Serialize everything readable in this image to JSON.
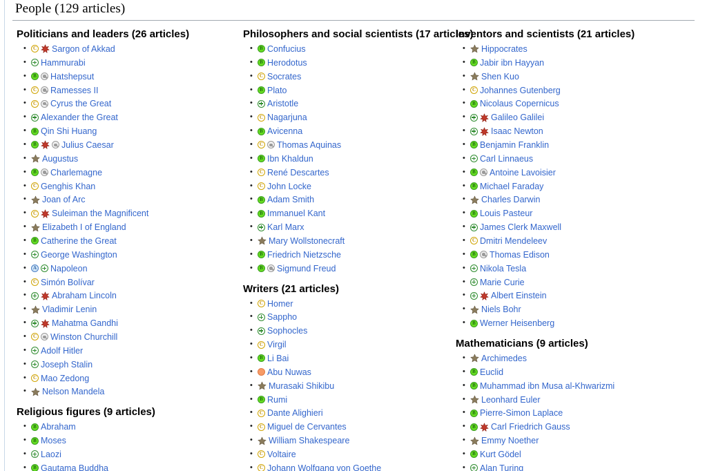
{
  "page": {
    "title": "People (129 articles)"
  },
  "icon_colors": {
    "featured_star": "#c0392b",
    "plain_star": "#8a7b5c",
    "b_class_green": "#66dd22",
    "c_class_yellow": "#d0a400",
    "a_class_blue": "#cfe4f7",
    "good_article_green": "#2e8b2e",
    "start_class_orange": "#f79b67",
    "grey_review": "#9a9a9a",
    "link_blue": "#3366cc"
  },
  "icon_names": {
    "B": "b-class-icon",
    "C": "c-class-icon",
    "A": "a-class-icon",
    "GA": "good-article-plus-icon",
    "FA": "featured-article-red-star-icon",
    "STAR": "bronze-star-icon",
    "START": "start-class-orange-circle-icon",
    "GREY": "grey-review-circle-icon"
  },
  "columns": [
    {
      "name": "column-one",
      "sections": [
        {
          "heading": "Politicians and leaders (26 articles)",
          "items": [
            {
              "icons": [
                "C",
                "FA"
              ],
              "label": "Sargon of Akkad"
            },
            {
              "icons": [
                "GA"
              ],
              "label": "Hammurabi"
            },
            {
              "icons": [
                "B",
                "GREY"
              ],
              "label": "Hatshepsut"
            },
            {
              "icons": [
                "C",
                "GREY"
              ],
              "label": "Ramesses II"
            },
            {
              "icons": [
                "C",
                "GREY"
              ],
              "label": "Cyrus the Great"
            },
            {
              "icons": [
                "GA"
              ],
              "label": "Alexander the Great"
            },
            {
              "icons": [
                "B"
              ],
              "label": "Qin Shi Huang"
            },
            {
              "icons": [
                "B",
                "FA",
                "GREY"
              ],
              "label": "Julius Caesar"
            },
            {
              "icons": [
                "STAR"
              ],
              "label": "Augustus"
            },
            {
              "icons": [
                "B",
                "GREY"
              ],
              "label": "Charlemagne"
            },
            {
              "icons": [
                "C"
              ],
              "label": "Genghis Khan"
            },
            {
              "icons": [
                "STAR"
              ],
              "label": "Joan of Arc"
            },
            {
              "icons": [
                "C",
                "FA"
              ],
              "label": "Suleiman the Magnificent"
            },
            {
              "icons": [
                "STAR"
              ],
              "label": "Elizabeth I of England"
            },
            {
              "icons": [
                "B"
              ],
              "label": "Catherine the Great"
            },
            {
              "icons": [
                "GA"
              ],
              "label": "George Washington"
            },
            {
              "icons": [
                "A",
                "GA"
              ],
              "label": "Napoleon"
            },
            {
              "icons": [
                "C"
              ],
              "label": "Simón Bolívar"
            },
            {
              "icons": [
                "GA",
                "FA"
              ],
              "label": "Abraham Lincoln"
            },
            {
              "icons": [
                "STAR"
              ],
              "label": "Vladimir Lenin"
            },
            {
              "icons": [
                "GA",
                "FA"
              ],
              "label": "Mahatma Gandhi"
            },
            {
              "icons": [
                "C",
                "GREY"
              ],
              "label": "Winston Churchill"
            },
            {
              "icons": [
                "GA"
              ],
              "label": "Adolf Hitler"
            },
            {
              "icons": [
                "GA"
              ],
              "label": "Joseph Stalin"
            },
            {
              "icons": [
                "C"
              ],
              "label": "Mao Zedong"
            },
            {
              "icons": [
                "STAR"
              ],
              "label": "Nelson Mandela"
            }
          ]
        },
        {
          "heading": "Religious figures (9 articles)",
          "items": [
            {
              "icons": [
                "B"
              ],
              "label": "Abraham"
            },
            {
              "icons": [
                "B"
              ],
              "label": "Moses"
            },
            {
              "icons": [
                "GA"
              ],
              "label": "Laozi"
            },
            {
              "icons": [
                "B"
              ],
              "label": "Gautama Buddha"
            }
          ]
        }
      ]
    },
    {
      "name": "column-two",
      "sections": [
        {
          "heading": "Philosophers and social scientists (17 articles)",
          "items": [
            {
              "icons": [
                "B"
              ],
              "label": "Confucius"
            },
            {
              "icons": [
                "B"
              ],
              "label": "Herodotus"
            },
            {
              "icons": [
                "C"
              ],
              "label": "Socrates"
            },
            {
              "icons": [
                "B"
              ],
              "label": "Plato"
            },
            {
              "icons": [
                "GA"
              ],
              "label": "Aristotle"
            },
            {
              "icons": [
                "C"
              ],
              "label": "Nagarjuna"
            },
            {
              "icons": [
                "B"
              ],
              "label": "Avicenna"
            },
            {
              "icons": [
                "C",
                "GREY"
              ],
              "label": "Thomas Aquinas"
            },
            {
              "icons": [
                "B"
              ],
              "label": "Ibn Khaldun"
            },
            {
              "icons": [
                "C"
              ],
              "label": "René Descartes"
            },
            {
              "icons": [
                "C"
              ],
              "label": "John Locke"
            },
            {
              "icons": [
                "B"
              ],
              "label": "Adam Smith"
            },
            {
              "icons": [
                "B"
              ],
              "label": "Immanuel Kant"
            },
            {
              "icons": [
                "GA"
              ],
              "label": "Karl Marx"
            },
            {
              "icons": [
                "STAR"
              ],
              "label": "Mary Wollstonecraft"
            },
            {
              "icons": [
                "B"
              ],
              "label": "Friedrich Nietzsche"
            },
            {
              "icons": [
                "B",
                "GREY"
              ],
              "label": "Sigmund Freud"
            }
          ]
        },
        {
          "heading": "Writers (21 articles)",
          "items": [
            {
              "icons": [
                "C"
              ],
              "label": "Homer"
            },
            {
              "icons": [
                "GA"
              ],
              "label": "Sappho"
            },
            {
              "icons": [
                "GA"
              ],
              "label": "Sophocles"
            },
            {
              "icons": [
                "C"
              ],
              "label": "Virgil"
            },
            {
              "icons": [
                "B"
              ],
              "label": "Li Bai"
            },
            {
              "icons": [
                "START"
              ],
              "label": "Abu Nuwas"
            },
            {
              "icons": [
                "STAR"
              ],
              "label": "Murasaki Shikibu"
            },
            {
              "icons": [
                "B"
              ],
              "label": "Rumi"
            },
            {
              "icons": [
                "C"
              ],
              "label": "Dante Alighieri"
            },
            {
              "icons": [
                "C"
              ],
              "label": "Miguel de Cervantes"
            },
            {
              "icons": [
                "STAR"
              ],
              "label": "William Shakespeare"
            },
            {
              "icons": [
                "C"
              ],
              "label": "Voltaire"
            },
            {
              "icons": [
                "C"
              ],
              "label": "Johann Wolfgang von Goethe"
            }
          ]
        }
      ]
    },
    {
      "name": "column-three",
      "sections": [
        {
          "heading": "Inventors and scientists (21 articles)",
          "items": [
            {
              "icons": [
                "STAR"
              ],
              "label": "Hippocrates"
            },
            {
              "icons": [
                "B"
              ],
              "label": "Jabir ibn Hayyan"
            },
            {
              "icons": [
                "STAR"
              ],
              "label": "Shen Kuo"
            },
            {
              "icons": [
                "C"
              ],
              "label": "Johannes Gutenberg"
            },
            {
              "icons": [
                "B"
              ],
              "label": "Nicolaus Copernicus"
            },
            {
              "icons": [
                "GA",
                "FA"
              ],
              "label": "Galileo Galilei"
            },
            {
              "icons": [
                "GA",
                "FA"
              ],
              "label": "Isaac Newton"
            },
            {
              "icons": [
                "B"
              ],
              "label": "Benjamin Franklin"
            },
            {
              "icons": [
                "GA"
              ],
              "label": "Carl Linnaeus"
            },
            {
              "icons": [
                "B",
                "GREY"
              ],
              "label": "Antoine Lavoisier"
            },
            {
              "icons": [
                "B"
              ],
              "label": "Michael Faraday"
            },
            {
              "icons": [
                "STAR"
              ],
              "label": "Charles Darwin"
            },
            {
              "icons": [
                "B"
              ],
              "label": "Louis Pasteur"
            },
            {
              "icons": [
                "GA"
              ],
              "label": "James Clerk Maxwell"
            },
            {
              "icons": [
                "C"
              ],
              "label": "Dmitri Mendeleev"
            },
            {
              "icons": [
                "B",
                "GREY"
              ],
              "label": "Thomas Edison"
            },
            {
              "icons": [
                "GA"
              ],
              "label": "Nikola Tesla"
            },
            {
              "icons": [
                "GA"
              ],
              "label": "Marie Curie"
            },
            {
              "icons": [
                "GA",
                "FA"
              ],
              "label": "Albert Einstein"
            },
            {
              "icons": [
                "STAR"
              ],
              "label": "Niels Bohr"
            },
            {
              "icons": [
                "B"
              ],
              "label": "Werner Heisenberg"
            }
          ]
        },
        {
          "heading": "Mathematicians (9 articles)",
          "items": [
            {
              "icons": [
                "STAR"
              ],
              "label": "Archimedes"
            },
            {
              "icons": [
                "B"
              ],
              "label": "Euclid"
            },
            {
              "icons": [
                "B"
              ],
              "label": "Muhammad ibn Musa al-Khwarizmi"
            },
            {
              "icons": [
                "STAR"
              ],
              "label": "Leonhard Euler"
            },
            {
              "icons": [
                "B"
              ],
              "label": "Pierre-Simon Laplace"
            },
            {
              "icons": [
                "B",
                "FA"
              ],
              "label": "Carl Friedrich Gauss"
            },
            {
              "icons": [
                "STAR"
              ],
              "label": "Emmy Noether"
            },
            {
              "icons": [
                "B"
              ],
              "label": "Kurt Gödel"
            },
            {
              "icons": [
                "GA"
              ],
              "label": "Alan Turing"
            }
          ]
        }
      ]
    }
  ]
}
